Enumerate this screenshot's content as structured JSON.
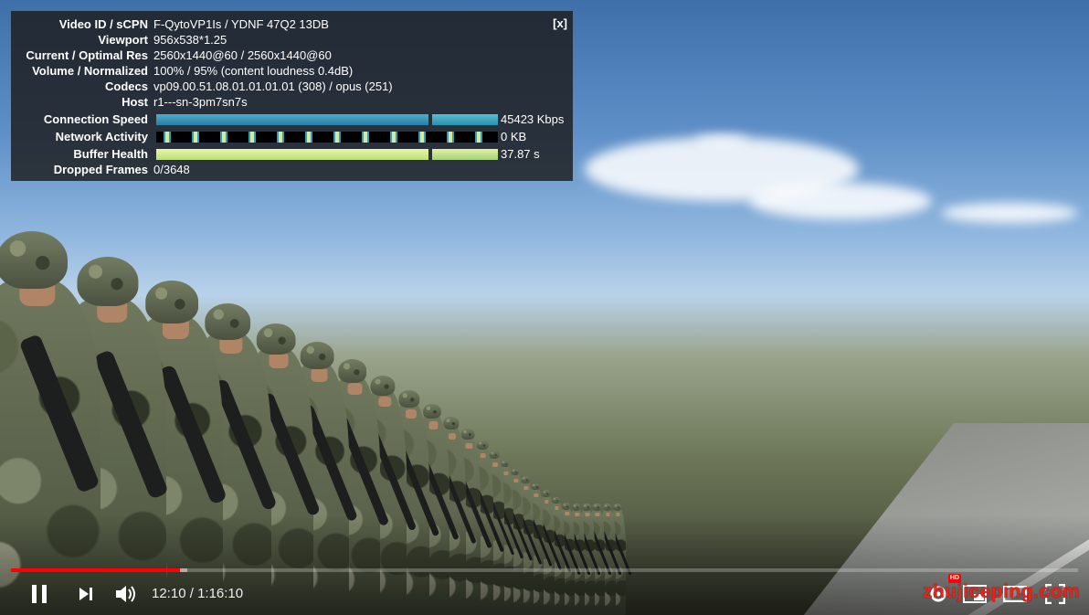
{
  "stats_panel": {
    "close_label": "[x]",
    "rows": [
      {
        "label": "Video ID / sCPN",
        "value": "F-QytoVP1Is / YDNF 47Q2 13DB"
      },
      {
        "label": "Viewport",
        "value": "956x538*1.25"
      },
      {
        "label": "Current / Optimal Res",
        "value": "2560x1440@60 / 2560x1440@60"
      },
      {
        "label": "Volume / Normalized",
        "value": "100% / 95% (content loudness 0.4dB)"
      },
      {
        "label": "Codecs",
        "value": "vp09.00.51.08.01.01.01.01 (308) / opus (251)"
      },
      {
        "label": "Host",
        "value": "r1---sn-3pm7sn7s"
      },
      {
        "label": "Connection Speed",
        "value": "45423 Kbps"
      },
      {
        "label": "Network Activity",
        "value": "0 KB"
      },
      {
        "label": "Buffer Health",
        "value": "37.87 s"
      },
      {
        "label": "Dropped Frames",
        "value": "0/3648"
      }
    ]
  },
  "player": {
    "progress": {
      "played_fraction": 0.158,
      "buffered_fraction": 0.165
    },
    "current_time": "12:10",
    "duration": "1:16:10",
    "time_display": "12:10 / 1:16:10",
    "hd_badge": "HD",
    "icons": [
      "pause-icon",
      "next-icon",
      "volume-icon",
      "settings-icon",
      "miniplayer-icon",
      "theater-icon",
      "fullscreen-icon"
    ]
  },
  "watermark": "zhujiceping.com",
  "colors": {
    "progress_played": "#ff0000",
    "watermark": "#e8231a",
    "panel_bg": "rgba(28,28,28,0.82)"
  }
}
